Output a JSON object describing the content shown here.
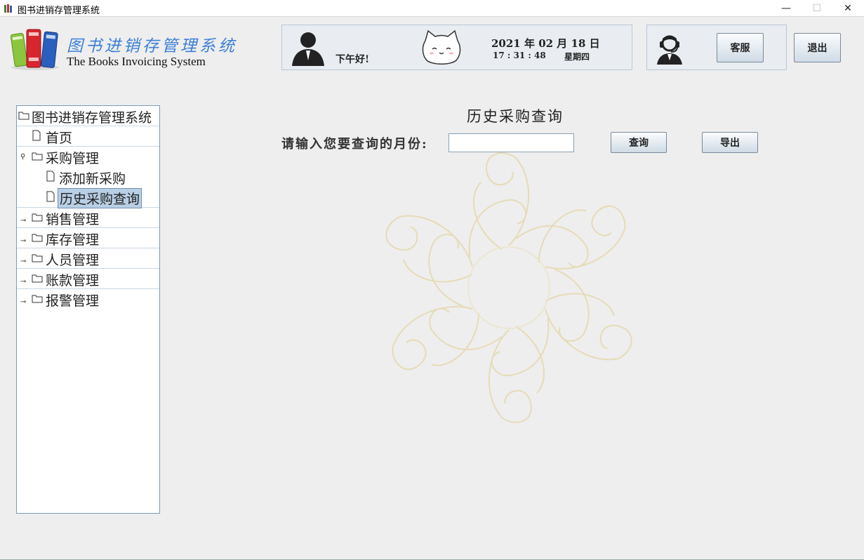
{
  "window": {
    "title": "图书进销存管理系统",
    "min_glyph": "—",
    "max_glyph": "☐",
    "close_glyph": "✕"
  },
  "logo": {
    "cn": "图书进销存管理系统",
    "en": "The Books Invoicing System"
  },
  "header": {
    "greeting": "下午好!",
    "date": "2021 年 02 月 18 日",
    "time": "17 : 31 : 48",
    "weekday": "星期四",
    "service_label": "客服",
    "logout_label": "退出"
  },
  "tree": {
    "root": "图书进销存管理系统",
    "home": "首页",
    "purchase": "采购管理",
    "purchase_children": [
      "添加新采购",
      "历史采购查询"
    ],
    "sales": "销售管理",
    "inventory": "库存管理",
    "staff": "人员管理",
    "accounts": "账款管理",
    "alerts": "报警管理"
  },
  "main": {
    "title": "历史采购查询",
    "query_label": "请输入您要查询的月份:",
    "month_value": "",
    "query_button": "查询",
    "export_button": "导出"
  },
  "colors": {
    "accent": "#3b7fd6",
    "selection": "#b8cfe5",
    "panel_border": "#b7c7d6"
  }
}
